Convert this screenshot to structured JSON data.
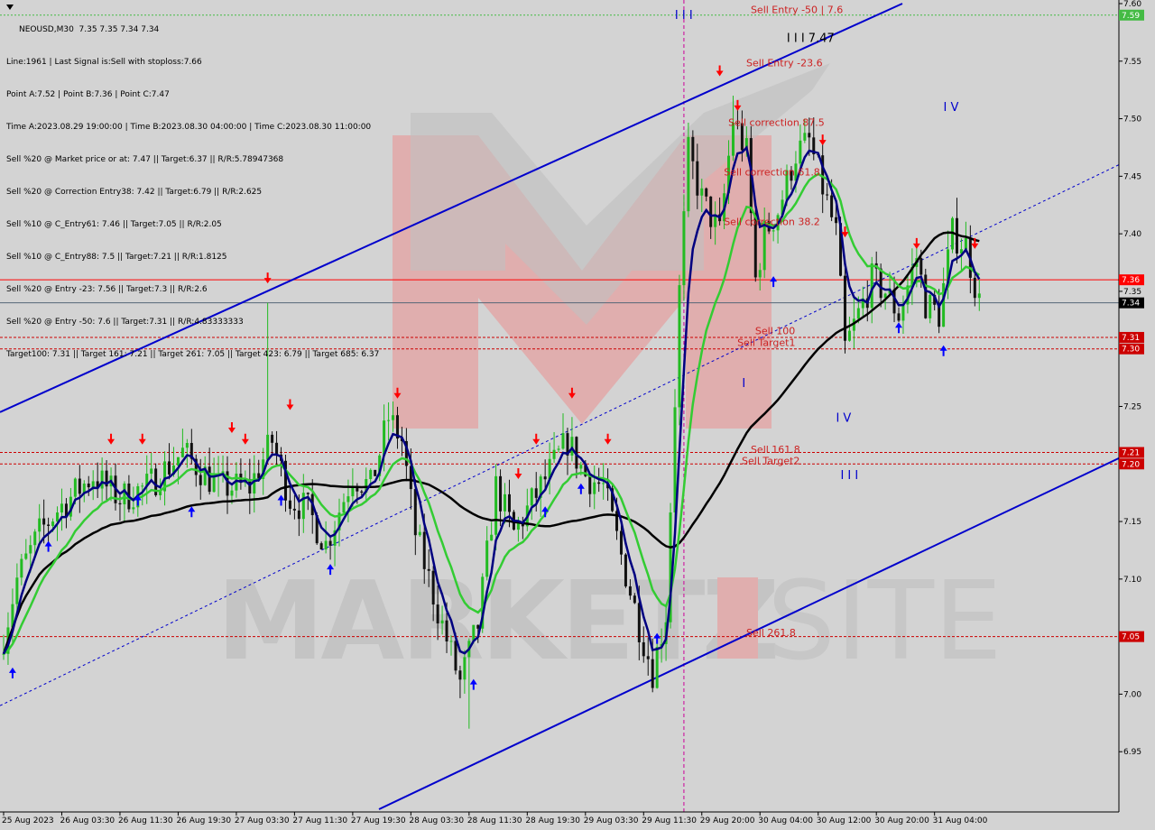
{
  "symbol_line": "NEOUSD,M30  7.35 7.35 7.34 7.34",
  "info_lines": [
    "Line:1961 | Last Signal is:Sell with stoploss:7.66",
    "Point A:7.52 | Point B:7.36 | Point C:7.47",
    "Time A:2023.08.29 19:00:00 | Time B:2023.08.30 04:00:00 | Time C:2023.08.30 11:00:00",
    "Sell %20 @ Market price or at: 7.47 || Target:6.37 || R/R:5.78947368",
    "Sell %20 @ Correction Entry38: 7.42 || Target:6.79 || R/R:2.625",
    "Sell %10 @ C_Entry61: 7.46 || Target:7.05 || R/R:2.05",
    "Sell %10 @ C_Entry88: 7.5 || Target:7.21 || R/R:1.8125",
    "Sell %20 @ Entry -23: 7.56 || Target:7.3 || R/R:2.6",
    "Sell %20 @ Entry -50: 7.6 || Target:7.31 || R/R:4.83333333",
    "Target100: 7.31 || Target 161: 7.21 || Target 261: 7.05 || Target 423: 6.79 || Target 685: 6.37"
  ],
  "chart_data": {
    "type": "candlestick",
    "symbol": "NEOUSD",
    "timeframe": "M30",
    "ylim": [
      6.9,
      7.6
    ],
    "y_ticks": [
      "7.60",
      "7.55",
      "7.50",
      "7.45",
      "7.40",
      "7.35",
      "7.30",
      "7.25",
      "7.20",
      "7.15",
      "7.10",
      "7.05",
      "7.00",
      "6.95"
    ],
    "x_ticks": [
      "25 Aug 2023",
      "26 Aug 03:30",
      "26 Aug 11:30",
      "26 Aug 19:30",
      "27 Aug 03:30",
      "27 Aug 11:30",
      "27 Aug 19:30",
      "28 Aug 03:30",
      "28 Aug 11:30",
      "28 Aug 19:30",
      "29 Aug 03:30",
      "29 Aug 11:30",
      "29 Aug 20:00",
      "30 Aug 04:00",
      "30 Aug 12:00",
      "30 Aug 20:00",
      "31 Aug 04:00"
    ],
    "price_labels": [
      {
        "text": "7.36",
        "value": 7.36,
        "color": "#ff0000"
      },
      {
        "text": "7.34",
        "value": 7.34,
        "color": "#000000"
      },
      {
        "text": "7.31",
        "value": 7.31,
        "color": "#cc0000"
      },
      {
        "text": "7.30",
        "value": 7.3,
        "color": "#cc0000"
      },
      {
        "text": "7.21",
        "value": 7.21,
        "color": "#cc0000"
      },
      {
        "text": "7.20",
        "value": 7.2,
        "color": "#cc0000"
      },
      {
        "text": "7.05",
        "value": 7.05,
        "color": "#cc0000"
      },
      {
        "text": "7.59",
        "value": 7.59,
        "color": "#44bb44"
      }
    ],
    "level_labels": [
      {
        "text": "Sell Entry -50 | 7.6",
        "value": 7.594,
        "x_bar": 176
      },
      {
        "text": "Sell Entry -23.6",
        "value": 7.548,
        "x_bar": 175
      },
      {
        "text": "Sell correction 87.5",
        "value": 7.496,
        "x_bar": 171
      },
      {
        "text": "Sell correction 61.8",
        "value": 7.453,
        "x_bar": 170
      },
      {
        "text": "Sell correction 38.2",
        "value": 7.41,
        "x_bar": 170
      },
      {
        "text": "Sell 100",
        "value": 7.315,
        "x_bar": 177
      },
      {
        "text": "Sell Target1",
        "value": 7.305,
        "x_bar": 173
      },
      {
        "text": "Sell 161.8",
        "value": 7.212,
        "x_bar": 176
      },
      {
        "text": "Sell Target2",
        "value": 7.202,
        "x_bar": 174
      },
      {
        "text": "Sell  261.8",
        "value": 7.053,
        "x_bar": 175
      }
    ],
    "wave_labels": [
      {
        "text": "I I I",
        "value": 7.59,
        "x_bar": 152
      },
      {
        "text": "I I I 7.47",
        "value": 7.57,
        "x_bar": 177
      },
      {
        "text": "I V",
        "value": 7.51,
        "x_bar": 212
      },
      {
        "text": "I",
        "value": 7.27,
        "x_bar": 167
      },
      {
        "text": "I V",
        "value": 7.24,
        "x_bar": 188
      },
      {
        "text": "I I I",
        "value": 7.19,
        "x_bar": 189
      }
    ],
    "colors": {
      "bull": "#22bb22",
      "bear": "#111111",
      "ma_fast": "#000080",
      "ma_mid": "#33cc33",
      "ma_slow": "#000000",
      "channel": "#0000cc",
      "sell_arrow": "#ff0000",
      "buy_arrow": "#0000ff",
      "level": "#cc0000"
    }
  }
}
